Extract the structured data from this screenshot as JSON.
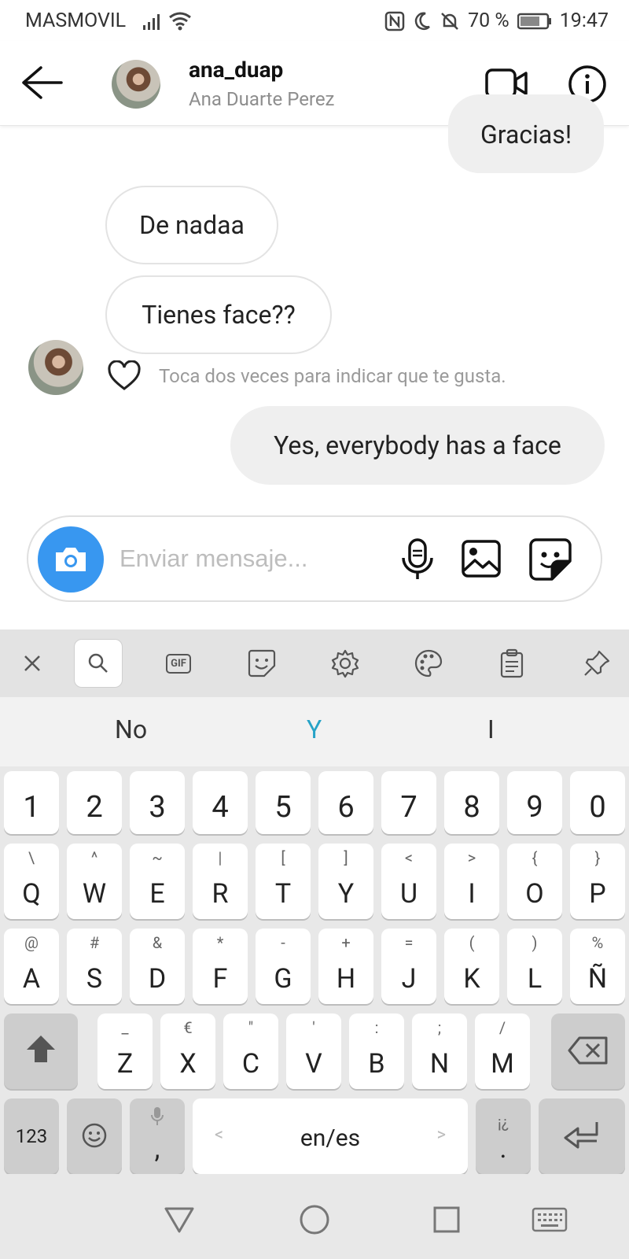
{
  "status_bar": {
    "carrier": "MASMOVIL",
    "battery": "70 %",
    "time": "19:47"
  },
  "header": {
    "username": "ana_duap",
    "full_name": "Ana Duarte Perez"
  },
  "messages": [
    {
      "from": "me",
      "text": "Gracias!"
    },
    {
      "from": "them",
      "text": "De nadaa"
    },
    {
      "from": "them",
      "text": "Tienes face??"
    },
    {
      "from": "me",
      "text": "Yes, everybody has a face"
    }
  ],
  "like_hint": "Toca dos veces para indicar que te gusta.",
  "composer": {
    "placeholder": "Enviar mensaje..."
  },
  "keyboard": {
    "suggestions": [
      "No",
      "Y",
      "I"
    ],
    "number_row": [
      "1",
      "2",
      "3",
      "4",
      "5",
      "6",
      "7",
      "8",
      "9",
      "0"
    ],
    "row1": [
      {
        "main": "Q",
        "sub": "\\"
      },
      {
        "main": "W",
        "sub": "^"
      },
      {
        "main": "E",
        "sub": "~"
      },
      {
        "main": "R",
        "sub": "|"
      },
      {
        "main": "T",
        "sub": "["
      },
      {
        "main": "Y",
        "sub": "]"
      },
      {
        "main": "U",
        "sub": "<"
      },
      {
        "main": "I",
        "sub": ">"
      },
      {
        "main": "O",
        "sub": "{"
      },
      {
        "main": "P",
        "sub": "}"
      }
    ],
    "row2": [
      {
        "main": "A",
        "sub": "@"
      },
      {
        "main": "S",
        "sub": "#"
      },
      {
        "main": "D",
        "sub": "&"
      },
      {
        "main": "F",
        "sub": "*"
      },
      {
        "main": "G",
        "sub": "-"
      },
      {
        "main": "H",
        "sub": "+"
      },
      {
        "main": "J",
        "sub": "="
      },
      {
        "main": "K",
        "sub": "("
      },
      {
        "main": "L",
        "sub": ")"
      },
      {
        "main": "Ñ",
        "sub": "%"
      }
    ],
    "row3": [
      {
        "main": "Z",
        "sub": "_"
      },
      {
        "main": "X",
        "sub": "€"
      },
      {
        "main": "C",
        "sub": "\""
      },
      {
        "main": "V",
        "sub": "'"
      },
      {
        "main": "B",
        "sub": ":"
      },
      {
        "main": "N",
        "sub": ";"
      },
      {
        "main": "M",
        "sub": "/"
      }
    ],
    "key_123": "123",
    "comma": ",",
    "space_label": "en/es",
    "period": ".",
    "period_sub": "¡¿",
    "space_left": "<",
    "space_right": ">",
    "gif_label": "GIF"
  }
}
